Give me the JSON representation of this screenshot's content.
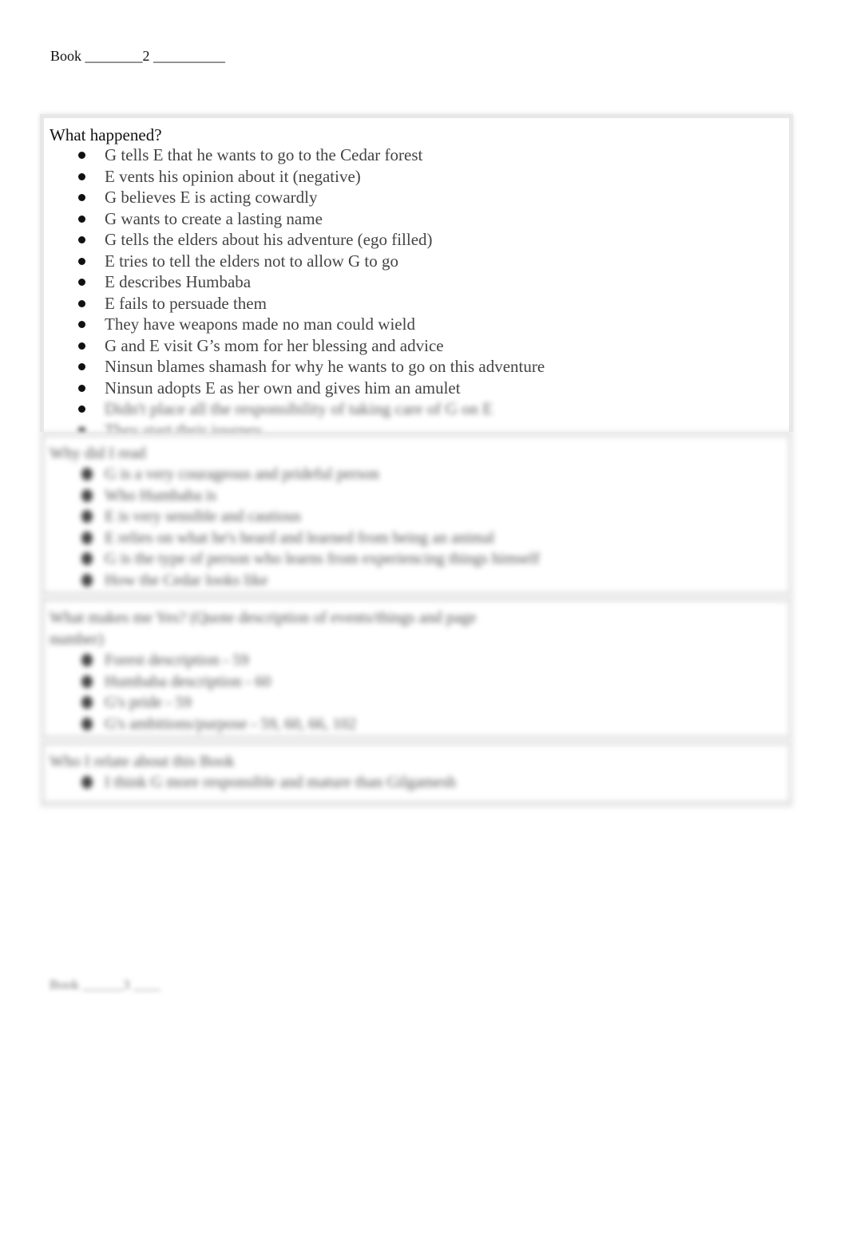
{
  "header": {
    "label": "Book",
    "blank_before": "________",
    "number": "2",
    "blank_after": "__________"
  },
  "sections": [
    {
      "title": "What happened?",
      "items": [
        "G tells E that he wants to go to the Cedar forest",
        "E vents his opinion about it (negative)",
        "G believes E is acting cowardly",
        "G wants to create a lasting name",
        "G tells the elders about his adventure (ego filled)",
        "E tries to tell the elders not to allow G to go",
        "E describes Humbaba",
        "E fails to persuade them",
        "They have weapons made no man could wield",
        "G and E visit G’s mom for her blessing and advice",
        "Ninsun blames shamash for why he wants to go on this adventure",
        "Ninsun adopts E as her own and gives him an amulet"
      ],
      "blurred_items": [
        "Didn't place all the responsibility of taking care of G on E",
        "They start their journey"
      ]
    },
    {
      "title": "Why did I read",
      "items": [
        "G is a very courageous and prideful person",
        "Who Humbaba is",
        "E is very sensible and cautious",
        "E relies on what he's heard and learned from being an animal",
        "G is the type of person who learns from experiencing things himself",
        "How the Cedar looks like"
      ]
    },
    {
      "title": "What makes me Yes? (Quote description of events/things and page",
      "title_cont": "number)",
      "items": [
        "Forest description - 59",
        "Humbaba description - 60",
        "G's pride - 59",
        "G's ambitions/purpose - 59, 60, 66, 102"
      ]
    },
    {
      "title": "Who I relate about this Book",
      "items": [
        "I think G more responsible and mature than Gilgamesh"
      ]
    }
  ],
  "footer": {
    "text": "Book ______3 ____"
  }
}
